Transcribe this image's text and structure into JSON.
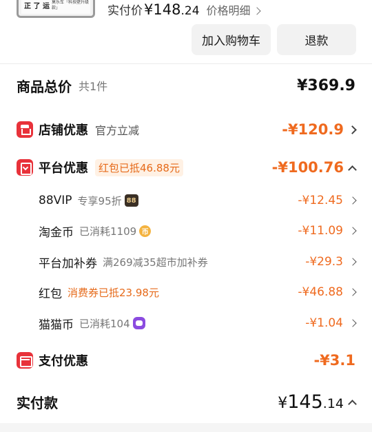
{
  "product": {
    "thumb_text": "正 了 运",
    "thumb_caption": "莫乐车「科技壁升级款」",
    "paid_label": "实付价",
    "paid_currency": "¥",
    "paid_int": "148",
    "paid_dec": ".24",
    "price_detail": "价格明细"
  },
  "actions": {
    "add_cart": "加入购物车",
    "refund": "退款"
  },
  "total": {
    "title": "商品总价",
    "count": "共1件",
    "amount": "¥369.9"
  },
  "shop_discount": {
    "title": "店铺优惠",
    "subtitle": "官方立减",
    "amount": "-¥120.9"
  },
  "platform_discount": {
    "title": "平台优惠",
    "tag": "红包已抵46.88元",
    "amount": "-¥100.76",
    "items": [
      {
        "label": "88VIP",
        "note": "专享95折",
        "badge": "88",
        "amount": "-¥12.45"
      },
      {
        "label": "淘金币",
        "note": "已消耗1109",
        "badge": "币",
        "amount": "-¥11.09"
      },
      {
        "label": "平台加补券",
        "note": "满269减35超市加补券",
        "amount": "-¥29.3"
      },
      {
        "label": "红包",
        "note": "消费券已抵23.98元",
        "amount": "-¥46.88"
      },
      {
        "label": "猫猫币",
        "note": "已消耗104",
        "amount": "-¥1.04"
      }
    ]
  },
  "pay_discount": {
    "title": "支付优惠",
    "amount": "-¥3.1"
  },
  "final": {
    "title": "实付款",
    "currency": "¥",
    "int": "145",
    "dec": ".14"
  },
  "colors": {
    "accent_orange": "#ef6a1f",
    "badge_red": "#e8323a"
  }
}
